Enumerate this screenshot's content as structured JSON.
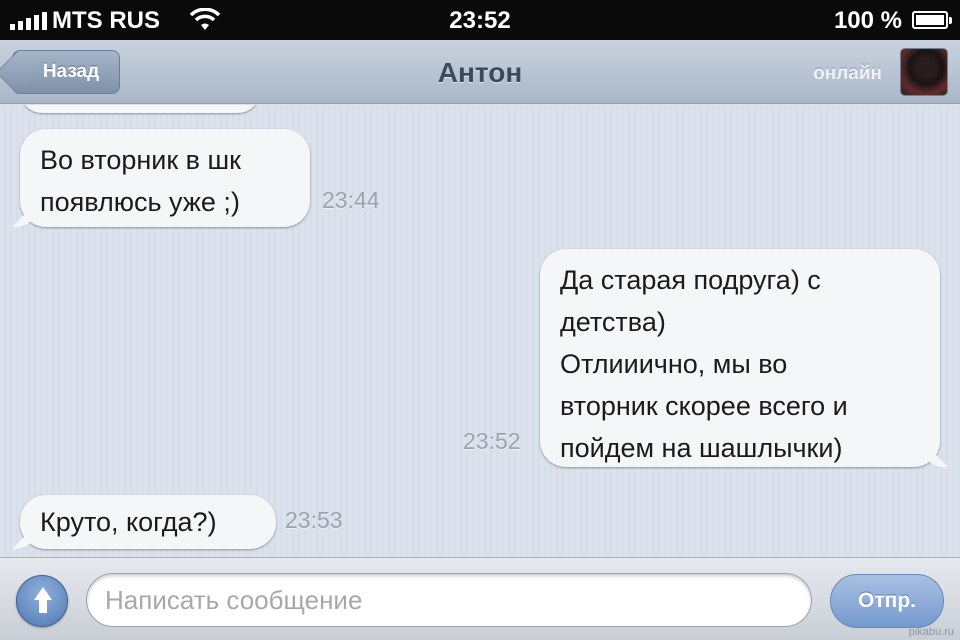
{
  "status_bar": {
    "carrier": "MTS RUS",
    "time": "23:52",
    "battery_percent": "100 %",
    "battery_level": 1.0
  },
  "nav": {
    "back_label": "Назад",
    "contact_name": "Антон",
    "presence": "онлайн"
  },
  "messages": [
    {
      "direction": "incoming",
      "text": "Во вторник в шк\nпоявлюсь уже ;)",
      "time": "23:44"
    },
    {
      "direction": "outgoing",
      "text": "Да старая подруга) с\nдетства)\nОтлииично, мы во\nвторник скорее всего и\nпойдем на шашлычки)",
      "time": "23:52"
    },
    {
      "direction": "incoming",
      "text": "Круто, когда?)",
      "time": "23:53"
    }
  ],
  "composer": {
    "placeholder": "Написать сообщение",
    "value": "",
    "send_label": "Отпр."
  },
  "icons": {
    "attach": "arrow-up-icon",
    "signal": "signal-bars-icon",
    "wifi": "wifi-icon",
    "battery": "battery-icon"
  },
  "watermark": "pikabu.ru"
}
